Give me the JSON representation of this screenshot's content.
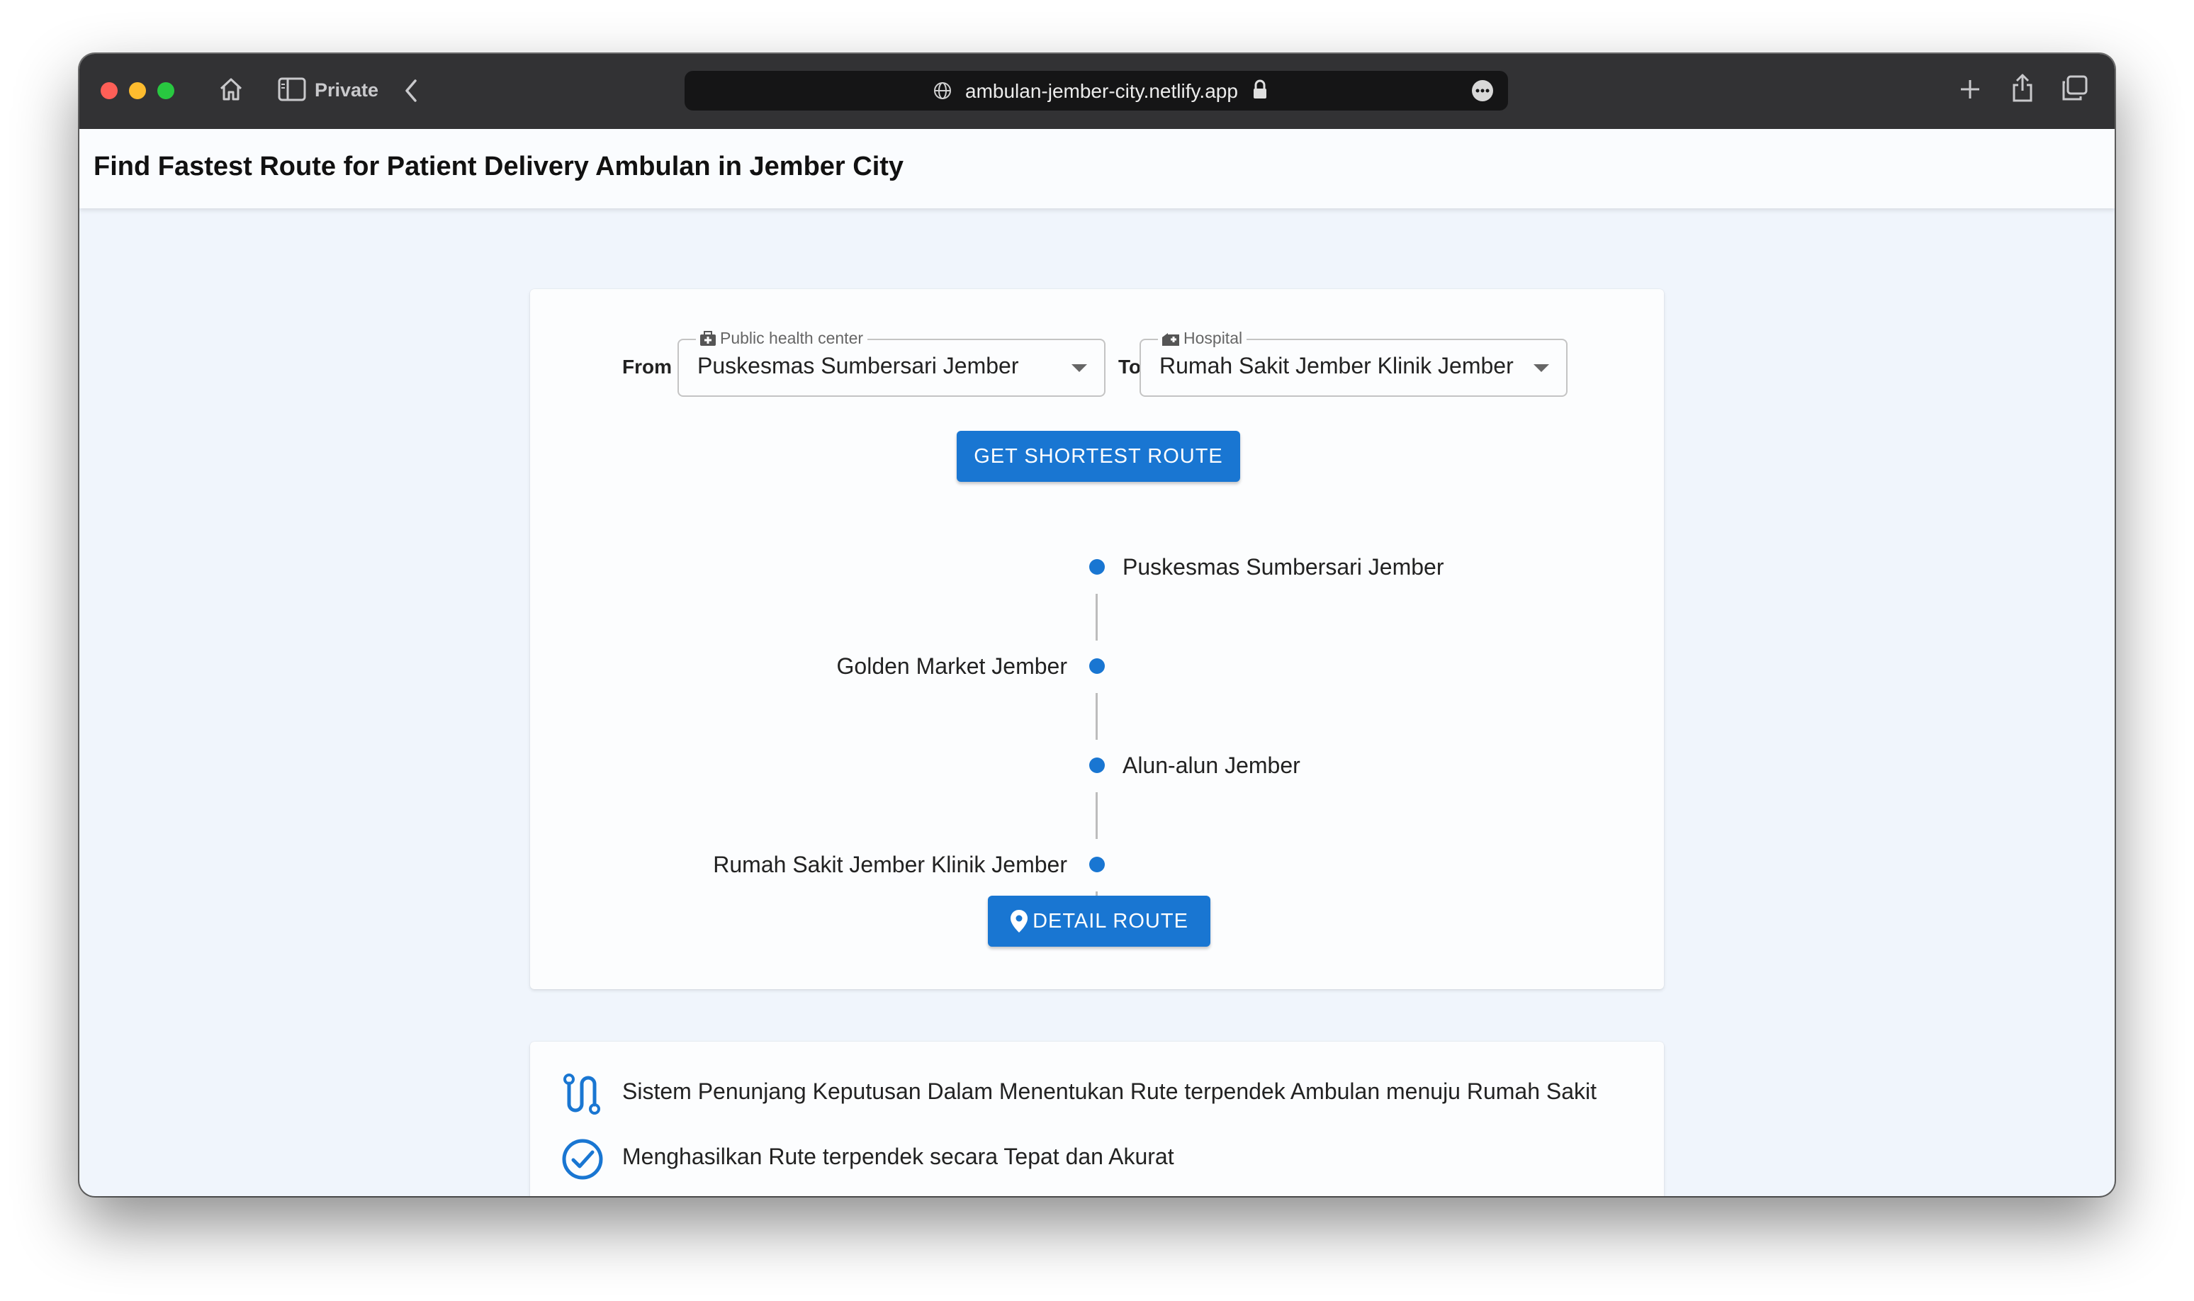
{
  "browser": {
    "private_label": "Private",
    "url": "ambulan-jember-city.netlify.app"
  },
  "app": {
    "title": "Find Fastest Route for Patient Delivery Ambulan in Jember City"
  },
  "form": {
    "from_label": "From",
    "to_label": "To",
    "origin": {
      "legend": "Public health center",
      "value": "Puskesmas Sumbersari Jember"
    },
    "destination": {
      "legend": "Hospital",
      "value": "Rumah Sakit Jember Klinik Jember"
    },
    "submit_label": "GET SHORTEST ROUTE",
    "detail_label": "DETAIL ROUTE"
  },
  "route": {
    "stops": [
      {
        "name": "Puskesmas Sumbersari Jember"
      },
      {
        "name": "Golden Market Jember"
      },
      {
        "name": "Alun-alun Jember"
      },
      {
        "name": "Rumah Sakit Jember Klinik Jember"
      }
    ]
  },
  "features": [
    {
      "icon": "route-icon",
      "text": "Sistem Penunjang Keputusan Dalam Menentukan Rute terpendek Ambulan menuju Rumah Sakit"
    },
    {
      "icon": "check-circle-icon",
      "text": "Menghasilkan Rute terpendek secara Tepat dan Akurat"
    }
  ],
  "colors": {
    "primary": "#1976d2",
    "background": "#f0f5fc",
    "card": "#fcfdfe",
    "titlebar": "#323234"
  }
}
